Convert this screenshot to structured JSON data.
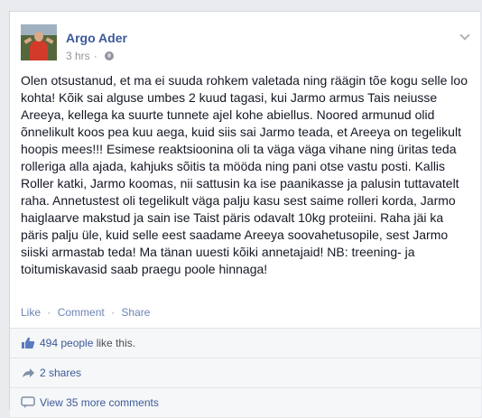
{
  "post": {
    "author": "Argo Ader",
    "timestamp": "3 hrs",
    "text": "Olen otsustanud, et ma ei suuda rohkem valetada ning räägin tõe kogu selle loo kohta! Kõik sai alguse umbes 2 kuud tagasi, kui Jarmo armus Tais neiusse Areeya, kellega ka suurte tunnete ajel kohe abiellus. Noored armunud olid õnnelikult koos pea kuu aega, kuid siis sai Jarmo teada, et Areeya on tegelikult hoopis mees!!! Esimese reaktsioonina oli ta väga väga vihane ning üritas teda rolleriga alla ajada, kahjuks sõitis ta mööda ning pani otse vastu posti. Kallis Roller katki, Jarmo koomas, nii sattusin ka ise paanikasse ja palusin tuttavatelt raha. Annetustest oli tegelikult väga palju kasu sest saime rolleri korda, Jarmo haiglaarve makstud ja sain ise Taist päris odavalt 10kg proteiini. Raha jäi ka päris palju üle, kuid selle eest saadame Areeya soovahetusopile, sest Jarmo siiski armastab teda! Ma tänan uuesti kõiki annetajaid! NB: treening- ja toitumiskavasid saab praegu poole hinnaga!"
  },
  "actions": {
    "like": "Like",
    "comment": "Comment",
    "share": "Share",
    "separator": "·"
  },
  "ufi": {
    "likes": "494 people",
    "likes_suffix": " like this.",
    "shares": "2 shares",
    "comments": "View 35 more comments"
  },
  "colors": {
    "link": "#3b5998",
    "action": "#6d84b4",
    "meta": "#90949c",
    "text": "#141823"
  },
  "icons": {
    "privacy": "globe-icon",
    "menu": "chevron-down-icon",
    "likes": "thumbs-up-icon",
    "shares": "share-arrow-icon",
    "comments": "speech-bubble-icon"
  }
}
